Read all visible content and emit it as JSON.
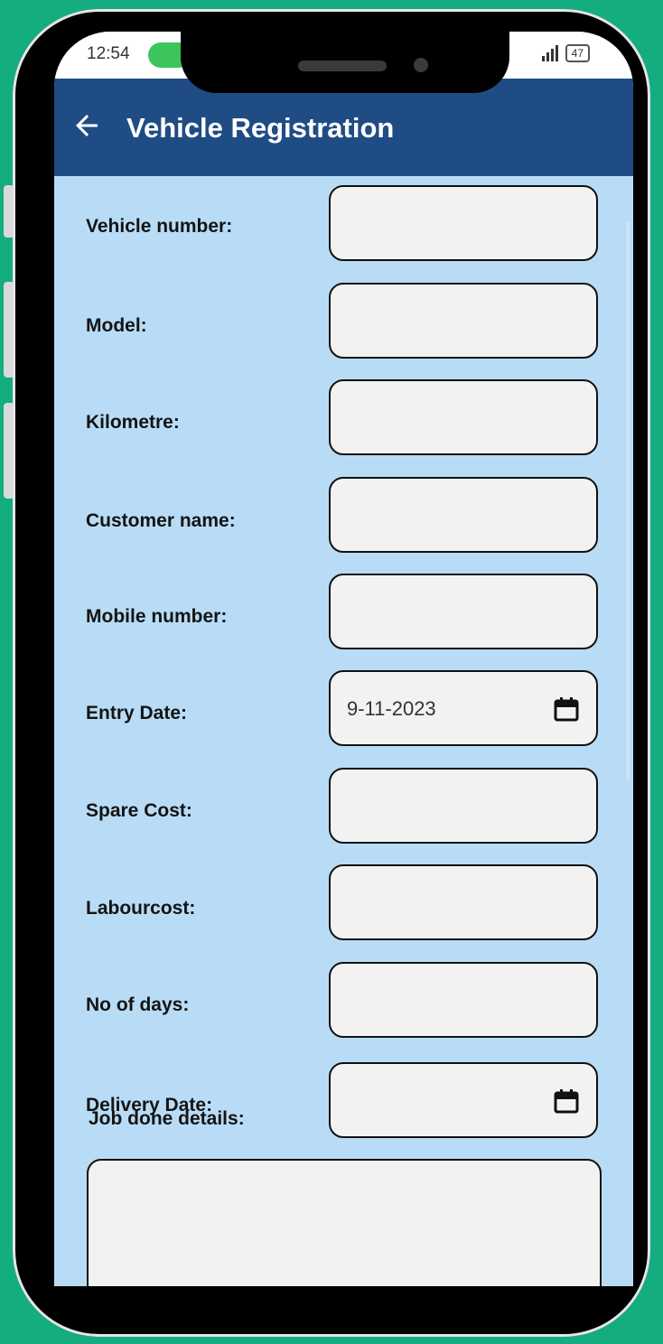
{
  "status_bar": {
    "time": "12:54",
    "battery": "47"
  },
  "app_bar": {
    "title": "Vehicle Registration",
    "back_icon": "arrow-left-icon"
  },
  "form": {
    "fields": [
      {
        "label": "Vehicle number:",
        "value": ""
      },
      {
        "label": "Model:",
        "value": ""
      },
      {
        "label": "Kilometre:",
        "value": ""
      },
      {
        "label": "Customer name:",
        "value": ""
      },
      {
        "label": "Mobile number:",
        "value": ""
      },
      {
        "label": "Entry Date:",
        "value": "9-11-2023",
        "icon": "calendar-icon"
      },
      {
        "label": "Spare Cost:",
        "value": ""
      },
      {
        "label": "Labourcost:",
        "value": ""
      },
      {
        "label": "No of days:",
        "value": ""
      },
      {
        "label": "Delivery Date:",
        "value": "",
        "icon": "calendar-icon"
      }
    ],
    "job_done_label": "Job done details:",
    "job_done_value": ""
  },
  "colors": {
    "background": "#13ad80",
    "app_bar": "#1f4c84",
    "form_background": "#b9dcf6"
  }
}
